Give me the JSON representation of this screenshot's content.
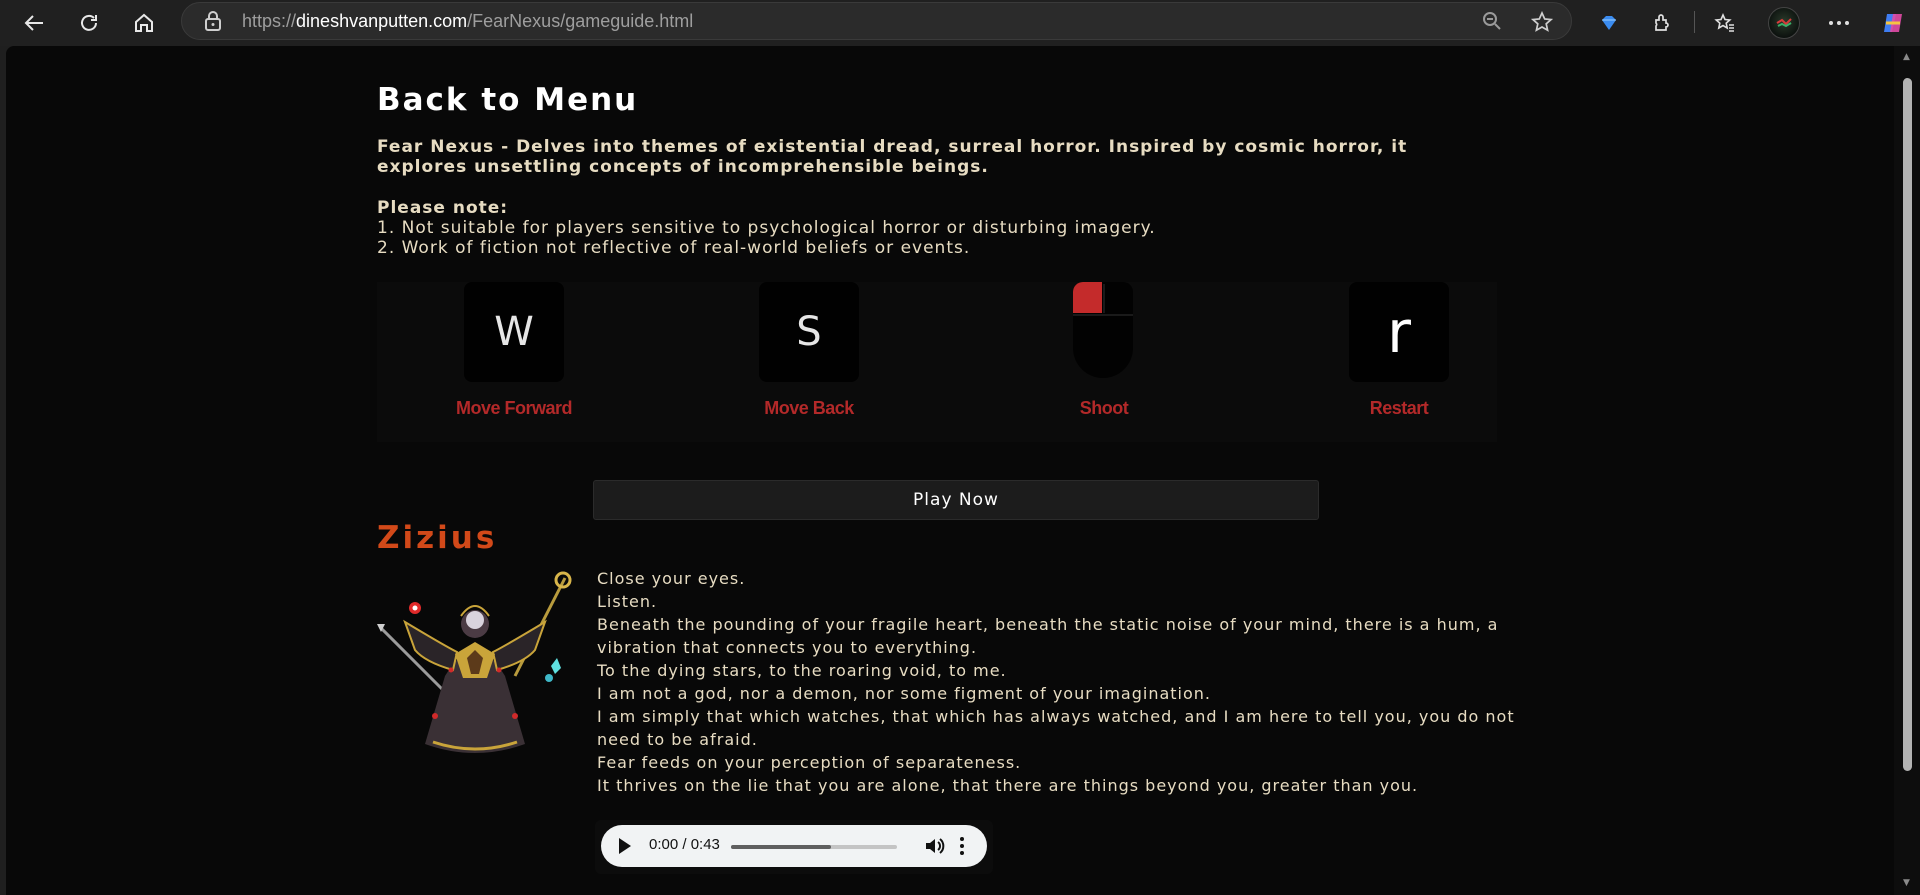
{
  "browser": {
    "url_prefix": "https://",
    "url_host": "dineshvanputten.com",
    "url_path": "/FearNexus/gameguide.html"
  },
  "page": {
    "back_link": "Back to Menu",
    "intro": "Fear Nexus - Delves into themes of existential dread, surreal horror. Inspired by cosmic horror, it explores unsettling concepts of incomprehensible beings.",
    "note_title": "Please note:",
    "notes": [
      "1. Not suitable for players sensitive to psychological horror or disturbing imagery.",
      "2. Work of fiction not reflective of real-world beliefs or events."
    ],
    "controls": [
      {
        "key": "W",
        "label": "Move Forward",
        "icon": "w-key-icon"
      },
      {
        "key": "S",
        "label": "Move Back",
        "icon": "s-key-icon"
      },
      {
        "key": "",
        "label": "Shoot",
        "icon": "mouse-left-click-icon"
      },
      {
        "key": "r",
        "label": "Restart",
        "icon": "r-key-icon"
      }
    ],
    "play_button": "Play Now",
    "character": {
      "name": "Zizius",
      "lines": [
        "Close your eyes.",
        "Listen.",
        "Beneath the pounding of your fragile heart, beneath the static noise of your mind, there is a hum, a vibration that connects you to everything.",
        "To the dying stars, to the roaring void, to me.",
        "I am not a god, nor a demon, nor some figment of your imagination.",
        "I am simply that which watches, that which has always watched, and I am here to tell you, you do not need to be afraid.",
        "Fear feeds on your perception of separateness.",
        "It thrives on the lie that you are alone, that there are things beyond you, greater than you."
      ],
      "audio": {
        "time": "0:00 / 0:43",
        "progress_percent": 60
      }
    }
  },
  "colors": {
    "accent_red": "#b32929",
    "title_orange": "#d24919",
    "text_cream": "#e7dcc2",
    "background": "#080808"
  }
}
